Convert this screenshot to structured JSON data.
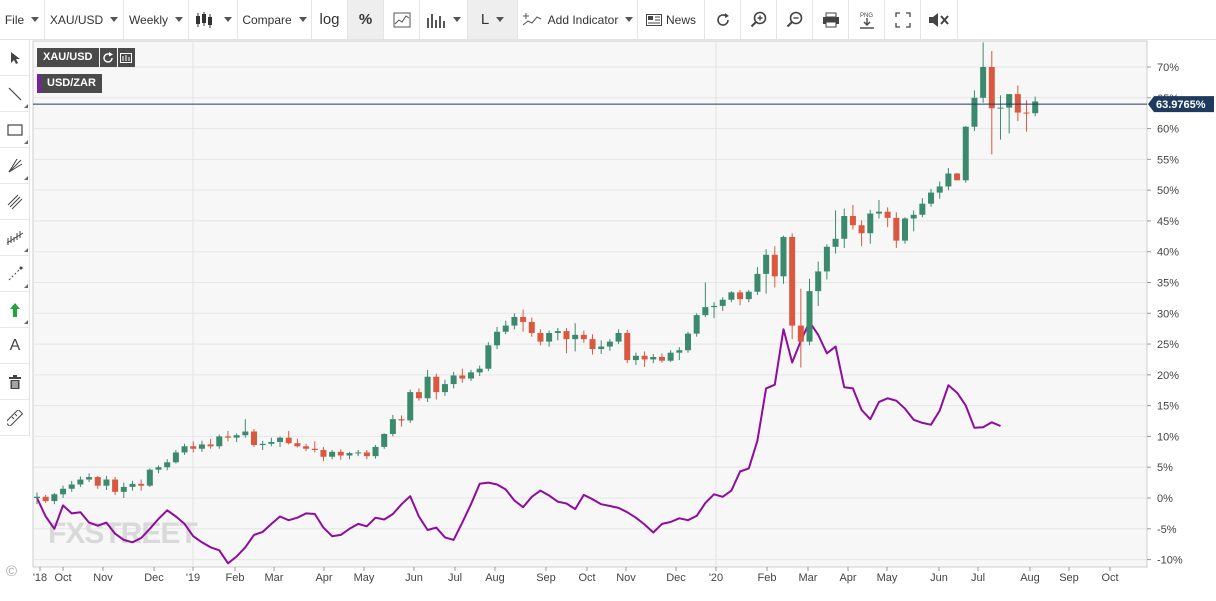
{
  "toolbar": {
    "file": "File",
    "symbol": "XAU/USD",
    "interval": "Weekly",
    "compare": "Compare",
    "log": "log",
    "percent": "%",
    "scale": "L",
    "add_indicator": "Add Indicator",
    "news": "News"
  },
  "legend": {
    "primary": "XAU/USD",
    "compare": "USD/ZAR"
  },
  "watermark": "FXSTREET",
  "copyright": "©",
  "colors": {
    "up": "#3b8a6e",
    "down": "#d9583f",
    "compare_line": "#8e0c9e",
    "last_price_line": "#1f3a5f",
    "label_bg": "#1f3a5f"
  },
  "chart_data": {
    "type": "candlestick",
    "yunit": "%",
    "ylim": [
      -10,
      75
    ],
    "y_ticks": [
      -10,
      -5,
      0,
      5,
      10,
      15,
      20,
      25,
      30,
      35,
      40,
      45,
      50,
      55,
      60,
      65,
      70
    ],
    "x_ticks": [
      "'18",
      "Oct",
      "Nov",
      "Dec",
      "'19",
      "Feb",
      "Mar",
      "Apr",
      "May",
      "Jun",
      "Jul",
      "Aug",
      "Sep",
      "Oct",
      "Nov",
      "Dec",
      "'20",
      "Feb",
      "Mar",
      "Apr",
      "May",
      "Jun",
      "Jul",
      "Aug",
      "Sep",
      "Oct"
    ],
    "last_value_label": "63.9765%",
    "last_value": 63.98,
    "grid": true,
    "series": [
      {
        "name": "XAU/USD",
        "kind": "candles",
        "ohlc": [
          [
            0.0,
            0.9,
            -1.0,
            0.2
          ],
          [
            0.2,
            0.5,
            -0.8,
            -0.5
          ],
          [
            -0.5,
            0.8,
            -1.0,
            0.6
          ],
          [
            0.6,
            2.0,
            0.0,
            1.5
          ],
          [
            1.5,
            2.8,
            1.0,
            2.2
          ],
          [
            2.2,
            3.5,
            1.8,
            3.0
          ],
          [
            3.0,
            4.0,
            2.6,
            3.4
          ],
          [
            3.4,
            3.6,
            1.5,
            2.0
          ],
          [
            2.0,
            3.6,
            1.3,
            3.0
          ],
          [
            3.0,
            3.4,
            0.5,
            1.0
          ],
          [
            1.0,
            2.5,
            0.0,
            1.8
          ],
          [
            1.8,
            2.8,
            1.2,
            2.3
          ],
          [
            2.3,
            3.0,
            1.2,
            2.0
          ],
          [
            2.0,
            4.8,
            1.8,
            4.6
          ],
          [
            4.6,
            5.3,
            4.0,
            5.0
          ],
          [
            5.0,
            6.3,
            4.5,
            5.8
          ],
          [
            5.8,
            7.8,
            5.6,
            7.4
          ],
          [
            7.4,
            8.8,
            7.0,
            8.4
          ],
          [
            8.4,
            9.2,
            7.4,
            8.0
          ],
          [
            8.0,
            9.3,
            7.5,
            8.7
          ],
          [
            8.7,
            9.6,
            8.0,
            8.4
          ],
          [
            8.4,
            10.3,
            8.0,
            10.0
          ],
          [
            10.0,
            10.9,
            9.2,
            9.8
          ],
          [
            9.8,
            10.5,
            9.1,
            10.2
          ],
          [
            10.2,
            12.8,
            9.8,
            10.8
          ],
          [
            10.8,
            11.2,
            8.3,
            8.6
          ],
          [
            8.6,
            9.3,
            7.8,
            8.8
          ],
          [
            8.8,
            9.8,
            8.4,
            9.1
          ],
          [
            9.1,
            10.0,
            8.3,
            9.8
          ],
          [
            9.8,
            10.9,
            8.7,
            8.9
          ],
          [
            8.9,
            9.6,
            8.2,
            8.4
          ],
          [
            8.4,
            8.8,
            7.6,
            8.0
          ],
          [
            8.0,
            9.2,
            7.4,
            7.8
          ],
          [
            7.8,
            8.3,
            6.0,
            6.7
          ],
          [
            6.7,
            7.8,
            6.3,
            7.5
          ],
          [
            7.5,
            7.9,
            6.2,
            6.9
          ],
          [
            6.9,
            7.5,
            6.3,
            7.3
          ],
          [
            7.3,
            7.8,
            6.8,
            7.4
          ],
          [
            7.4,
            7.8,
            6.3,
            6.8
          ],
          [
            6.8,
            8.6,
            6.4,
            8.3
          ],
          [
            8.3,
            10.5,
            8.0,
            10.4
          ],
          [
            10.4,
            13.5,
            10.0,
            12.8
          ],
          [
            12.8,
            13.4,
            11.6,
            12.6
          ],
          [
            12.6,
            17.6,
            12.2,
            17.2
          ],
          [
            17.2,
            17.8,
            15.8,
            16.2
          ],
          [
            16.2,
            20.8,
            15.6,
            19.7
          ],
          [
            19.7,
            20.2,
            16.0,
            17.2
          ],
          [
            17.2,
            19.2,
            16.6,
            18.5
          ],
          [
            18.5,
            20.5,
            17.8,
            19.9
          ],
          [
            19.9,
            21.0,
            18.7,
            19.4
          ],
          [
            19.4,
            20.8,
            19.0,
            20.4
          ],
          [
            20.4,
            21.5,
            19.8,
            21.0
          ],
          [
            21.0,
            25.3,
            20.6,
            24.8
          ],
          [
            24.8,
            27.8,
            24.2,
            27.0
          ],
          [
            27.0,
            28.8,
            26.6,
            28.0
          ],
          [
            28.0,
            30.0,
            27.4,
            29.4
          ],
          [
            29.4,
            30.6,
            27.0,
            28.6
          ],
          [
            28.6,
            29.3,
            26.2,
            26.8
          ],
          [
            26.8,
            27.4,
            24.8,
            25.4
          ],
          [
            25.4,
            27.2,
            24.6,
            26.8
          ],
          [
            26.8,
            27.6,
            25.6,
            27.1
          ],
          [
            27.1,
            27.6,
            23.5,
            25.8
          ],
          [
            25.8,
            28.4,
            23.8,
            26.5
          ],
          [
            26.5,
            27.2,
            25.2,
            25.8
          ],
          [
            25.8,
            26.6,
            23.3,
            24.2
          ],
          [
            24.2,
            25.6,
            23.4,
            24.6
          ],
          [
            24.6,
            25.8,
            23.9,
            25.4
          ],
          [
            25.4,
            27.4,
            25.0,
            26.8
          ],
          [
            26.8,
            27.3,
            21.9,
            22.4
          ],
          [
            22.4,
            23.6,
            21.6,
            23.1
          ],
          [
            23.1,
            23.8,
            21.3,
            22.5
          ],
          [
            22.5,
            23.4,
            21.9,
            22.9
          ],
          [
            22.9,
            23.5,
            22.0,
            22.3
          ],
          [
            22.3,
            24.0,
            22.1,
            23.6
          ],
          [
            23.6,
            24.5,
            22.4,
            24.0
          ],
          [
            24.0,
            27.0,
            23.6,
            26.7
          ],
          [
            26.7,
            30.0,
            26.2,
            29.7
          ],
          [
            29.7,
            35.0,
            29.4,
            31.0
          ],
          [
            31.0,
            31.8,
            29.2,
            31.2
          ],
          [
            31.2,
            32.6,
            30.4,
            32.2
          ],
          [
            32.2,
            33.6,
            31.8,
            33.4
          ],
          [
            33.4,
            33.8,
            31.3,
            32.3
          ],
          [
            32.3,
            33.8,
            31.8,
            33.5
          ],
          [
            33.5,
            37.5,
            33.0,
            36.4
          ],
          [
            36.4,
            40.4,
            33.2,
            39.5
          ],
          [
            39.5,
            40.9,
            34.2,
            36.0
          ],
          [
            36.0,
            42.6,
            34.8,
            42.4
          ],
          [
            42.4,
            43.0,
            25.8,
            28.0
          ],
          [
            28.0,
            34.0,
            21.2,
            25.4
          ],
          [
            25.4,
            35.6,
            24.8,
            33.6
          ],
          [
            33.6,
            38.4,
            31.2,
            36.8
          ],
          [
            36.8,
            41.2,
            35.5,
            40.8
          ],
          [
            40.8,
            46.7,
            39.7,
            42.1
          ],
          [
            42.1,
            47.0,
            40.6,
            45.8
          ],
          [
            45.8,
            47.6,
            43.6,
            44.3
          ],
          [
            44.3,
            45.1,
            40.9,
            43.0
          ],
          [
            43.0,
            46.8,
            41.3,
            46.2
          ],
          [
            46.2,
            48.4,
            45.4,
            46.5
          ],
          [
            46.5,
            47.2,
            44.0,
            45.5
          ],
          [
            45.5,
            46.4,
            40.6,
            41.8
          ],
          [
            41.8,
            45.6,
            41.3,
            45.4
          ],
          [
            45.4,
            46.7,
            43.3,
            46.0
          ],
          [
            46.0,
            48.7,
            45.6,
            47.8
          ],
          [
            47.8,
            50.2,
            47.3,
            49.6
          ],
          [
            49.6,
            51.4,
            48.6,
            50.6
          ],
          [
            50.6,
            53.6,
            50.0,
            52.7
          ],
          [
            52.7,
            52.8,
            51.6,
            51.6
          ],
          [
            51.6,
            60.4,
            51.2,
            60.3
          ],
          [
            60.3,
            66.2,
            59.6,
            65.0
          ],
          [
            65.0,
            74.0,
            64.2,
            70.0
          ],
          [
            70.0,
            72.6,
            55.8,
            63.3
          ],
          [
            63.3,
            65.4,
            58.2,
            63.4
          ],
          [
            63.4,
            65.6,
            59.2,
            65.6
          ],
          [
            65.6,
            67.0,
            61.2,
            62.6
          ],
          [
            62.6,
            64.6,
            59.5,
            62.5
          ],
          [
            62.5,
            65.2,
            62.0,
            64.4
          ]
        ]
      },
      {
        "name": "USD/ZAR",
        "kind": "line",
        "values": [
          0.0,
          -3.0,
          -5.0,
          -1.2,
          -2.5,
          -2.3,
          -4.0,
          -4.5,
          -4.0,
          -5.8,
          -6.8,
          -7.2,
          -6.5,
          -5.0,
          -3.4,
          -2.0,
          -3.0,
          -4.2,
          -6.2,
          -7.2,
          -8.0,
          -8.5,
          -10.6,
          -9.5,
          -8.0,
          -6.0,
          -5.5,
          -4.2,
          -3.0,
          -3.6,
          -3.2,
          -2.5,
          -2.6,
          -4.8,
          -6.2,
          -6.0,
          -5.0,
          -4.2,
          -4.6,
          -3.2,
          -3.5,
          -2.6,
          -1.0,
          0.3,
          -3.0,
          -5.2,
          -4.8,
          -6.4,
          -6.8,
          -4.0,
          -1.0,
          2.3,
          2.5,
          2.2,
          1.4,
          -0.4,
          -1.5,
          0.2,
          1.2,
          0.4,
          -0.6,
          -0.9,
          -1.8,
          0.5,
          -0.2,
          -1.0,
          -1.3,
          -1.6,
          -2.3,
          -3.2,
          -4.3,
          -5.6,
          -4.2,
          -3.9,
          -3.3,
          -3.6,
          -2.9,
          -0.8,
          0.6,
          0.2,
          1.2,
          4.3,
          4.8,
          9.3,
          17.8,
          18.4,
          27.4,
          22.0,
          25.5,
          28.6,
          26.5,
          23.5,
          24.6,
          18.0,
          17.8,
          14.3,
          12.8,
          15.6,
          16.2,
          15.8,
          14.5,
          12.7,
          12.2,
          11.9,
          14.2,
          18.3,
          17.1,
          15.0,
          11.4,
          11.5,
          12.3,
          11.7
        ]
      }
    ]
  }
}
